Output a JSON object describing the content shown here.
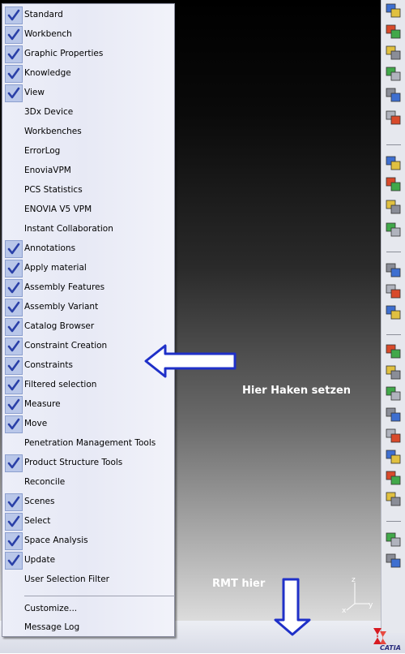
{
  "context_menu": {
    "items": [
      {
        "label": "Standard",
        "checked": true
      },
      {
        "label": "Workbench",
        "checked": true
      },
      {
        "label": "Graphic Properties",
        "checked": true
      },
      {
        "label": "Knowledge",
        "checked": true
      },
      {
        "label": "View",
        "checked": true
      },
      {
        "label": "3Dx Device",
        "checked": false
      },
      {
        "label": "Workbenches",
        "checked": false
      },
      {
        "label": "ErrorLog",
        "checked": false
      },
      {
        "label": "EnoviaVPM",
        "checked": false
      },
      {
        "label": "PCS Statistics",
        "checked": false
      },
      {
        "label": "ENOVIA V5 VPM",
        "checked": false
      },
      {
        "label": "Instant Collaboration",
        "checked": false
      },
      {
        "label": "Annotations",
        "checked": true
      },
      {
        "label": "Apply material",
        "checked": true
      },
      {
        "label": "Assembly Features",
        "checked": true
      },
      {
        "label": "Assembly Variant",
        "checked": true
      },
      {
        "label": "Catalog Browser",
        "checked": true
      },
      {
        "label": "Constraint Creation",
        "checked": true
      },
      {
        "label": "Constraints",
        "checked": true
      },
      {
        "label": "Filtered selection",
        "checked": true
      },
      {
        "label": "Measure",
        "checked": true
      },
      {
        "label": "Move",
        "checked": true
      },
      {
        "label": "Penetration Management Tools",
        "checked": false
      },
      {
        "label": "Product Structure Tools",
        "checked": true
      },
      {
        "label": "Reconcile",
        "checked": false
      },
      {
        "label": "Scenes",
        "checked": true
      },
      {
        "label": "Select",
        "checked": true
      },
      {
        "label": "Space Analysis",
        "checked": true
      },
      {
        "label": "Update",
        "checked": true
      },
      {
        "label": "User Selection Filter",
        "checked": false
      }
    ],
    "footer_items": [
      {
        "label": "Customize..."
      },
      {
        "label": "Message Log"
      }
    ]
  },
  "annotations": {
    "constraints_hint": "Hier Haken setzen",
    "right_click_hint": "RMT hier"
  },
  "axis": {
    "y": "y",
    "z": "z",
    "x": "x"
  },
  "logo": {
    "text": "CATIA"
  },
  "toolbar_icons": [
    "select-icon",
    "update-icon",
    "text-block-icon",
    "catalog-icon",
    "product-icon",
    "gear-icon",
    "fly-mode-icon",
    "zoom-fit-icon",
    "star-wand-icon",
    "insert-component-icon",
    "insert-product-icon",
    "insert-part-icon",
    "manipulation-icon",
    "snap-icon",
    "explode-icon",
    "measure-icon",
    "anchor-icon",
    "pencil-icon",
    "grid-icon",
    "chain-icon",
    "link-icon",
    "refresh-icon",
    "hierarchy-icon"
  ],
  "colors": {
    "check_bg": "#b9c7e9",
    "check_mark": "#2a40a8",
    "arrow_blue": "#1f30c8"
  }
}
